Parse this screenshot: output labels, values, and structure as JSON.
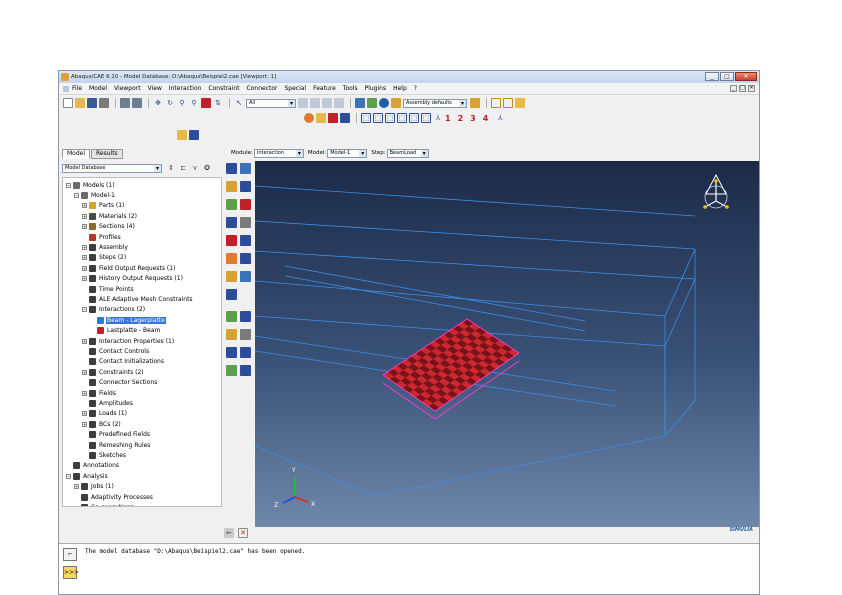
{
  "window": {
    "title": "Abaqus/CAE 6.10 - Model Database: D:\\Abaqus\\Beispiel2.cae [Viewport: 1]",
    "minimize": "_",
    "maximize": "□",
    "close": "✕"
  },
  "menu": [
    "File",
    "Model",
    "Viewport",
    "View",
    "Interaction",
    "Constraint",
    "Connector",
    "Special",
    "Feature",
    "Tools",
    "Plugins",
    "Help",
    "?"
  ],
  "toolbar": {
    "view_selector": "All",
    "assembly_display": "Assembly defaults",
    "view_numbers": [
      "1",
      "2",
      "3",
      "4"
    ]
  },
  "tree_tabs": [
    "Model",
    "Results"
  ],
  "tree_selector": "Model Database",
  "tree": [
    {
      "label": "Models (1)",
      "icon": "models-icon",
      "color": "#6a6a6a",
      "indent": 0,
      "expander": "−"
    },
    {
      "label": "Model-1",
      "icon": "model-icon",
      "color": "#6a6a6a",
      "indent": 1,
      "expander": "−"
    },
    {
      "label": "Parts (1)",
      "icon": "parts-icon",
      "color": "#d7a234",
      "indent": 2,
      "expander": "+"
    },
    {
      "label": "Materials (2)",
      "icon": "materials-icon",
      "color": "#4b4b4b",
      "indent": 2,
      "expander": "+"
    },
    {
      "label": "Sections (4)",
      "icon": "sections-icon",
      "color": "#8c6a2e",
      "indent": 2,
      "expander": "+"
    },
    {
      "label": "Profiles",
      "icon": "profiles-icon",
      "color": "#b33a2a",
      "indent": 2,
      "expander": ""
    },
    {
      "label": "Assembly",
      "icon": "assembly-icon",
      "color": "#3d3d3d",
      "indent": 2,
      "expander": "+"
    },
    {
      "label": "Steps (2)",
      "icon": "steps-icon",
      "color": "#3d3d3d",
      "indent": 2,
      "expander": "+"
    },
    {
      "label": "Field Output Requests (1)",
      "icon": "field-output-icon",
      "color": "#3d3d3d",
      "indent": 2,
      "expander": "+"
    },
    {
      "label": "History Output Requests (1)",
      "icon": "history-output-icon",
      "color": "#3d3d3d",
      "indent": 2,
      "expander": "+"
    },
    {
      "label": "Time Points",
      "icon": "time-points-icon",
      "color": "#3d3d3d",
      "indent": 2,
      "expander": ""
    },
    {
      "label": "ALE Adaptive Mesh Constraints",
      "icon": "ale-mesh-icon",
      "color": "#3d3d3d",
      "indent": 2,
      "expander": ""
    },
    {
      "label": "Interactions (2)",
      "icon": "interactions-icon",
      "color": "#3d3d3d",
      "indent": 2,
      "expander": "−"
    },
    {
      "label": "Beam - Lagerplatte",
      "icon": "interaction-item-icon",
      "color": "#3478d4",
      "indent": 3,
      "expander": "",
      "selected": true
    },
    {
      "label": "Lastplatte - Beam",
      "icon": "interaction-error-icon",
      "color": "#c0202a",
      "indent": 3,
      "expander": ""
    },
    {
      "label": "Interaction Properties (1)",
      "icon": "interaction-properties-icon",
      "color": "#3d3d3d",
      "indent": 2,
      "expander": "+"
    },
    {
      "label": "Contact Controls",
      "icon": "contact-controls-icon",
      "color": "#3d3d3d",
      "indent": 2,
      "expander": ""
    },
    {
      "label": "Contact Initializations",
      "icon": "contact-init-icon",
      "color": "#3d3d3d",
      "indent": 2,
      "expander": ""
    },
    {
      "label": "Constraints (2)",
      "icon": "constraints-icon",
      "color": "#3d3d3d",
      "indent": 2,
      "expander": "+"
    },
    {
      "label": "Connector Sections",
      "icon": "connector-sections-icon",
      "color": "#3d3d3d",
      "indent": 2,
      "expander": ""
    },
    {
      "label": "Fields",
      "icon": "fields-icon",
      "color": "#3d3d3d",
      "indent": 2,
      "expander": "+"
    },
    {
      "label": "Amplitudes",
      "icon": "amplitudes-icon",
      "color": "#3d3d3d",
      "indent": 2,
      "expander": ""
    },
    {
      "label": "Loads (1)",
      "icon": "loads-icon",
      "color": "#3d3d3d",
      "indent": 2,
      "expander": "+"
    },
    {
      "label": "BCs (2)",
      "icon": "bcs-icon",
      "color": "#3d3d3d",
      "indent": 2,
      "expander": "+"
    },
    {
      "label": "Predefined Fields",
      "icon": "predefined-fields-icon",
      "color": "#3d3d3d",
      "indent": 2,
      "expander": ""
    },
    {
      "label": "Remeshing Rules",
      "icon": "remeshing-rules-icon",
      "color": "#3d3d3d",
      "indent": 2,
      "expander": ""
    },
    {
      "label": "Sketches",
      "icon": "sketches-icon",
      "color": "#3d3d3d",
      "indent": 2,
      "expander": ""
    },
    {
      "label": "Annotations",
      "icon": "annotations-icon",
      "color": "#3d3d3d",
      "indent": 0,
      "expander": ""
    },
    {
      "label": "Analysis",
      "icon": "analysis-icon",
      "color": "#3d3d3d",
      "indent": 0,
      "expander": "−"
    },
    {
      "label": "Jobs (1)",
      "icon": "jobs-icon",
      "color": "#3d3d3d",
      "indent": 1,
      "expander": "+"
    },
    {
      "label": "Adaptivity Processes",
      "icon": "adaptivity-icon",
      "color": "#3d3d3d",
      "indent": 1,
      "expander": ""
    },
    {
      "label": "Co-executions",
      "icon": "co-executions-icon",
      "color": "#3d3d3d",
      "indent": 1,
      "expander": ""
    }
  ],
  "context": {
    "module_label": "Module:",
    "module_value": "Interaction",
    "model_label": "Model:",
    "model_value": "Model-1",
    "step_label": "Step:",
    "step_value": "BeamLoad"
  },
  "axis_triad": {
    "y": "Y",
    "z": "Z",
    "x": "X"
  },
  "brand": "SIMULIA",
  "message": "The model database \"D:\\Abaqus\\Beispiel2.cae\" has been opened.",
  "prompt_button": ">>>",
  "colors": {
    "wire": "#3d8fe8",
    "surface": "#d0262c",
    "highlight": "#ff3bd1",
    "viewport_top": "#1c2a48",
    "viewport_bottom": "#6f88aa"
  }
}
